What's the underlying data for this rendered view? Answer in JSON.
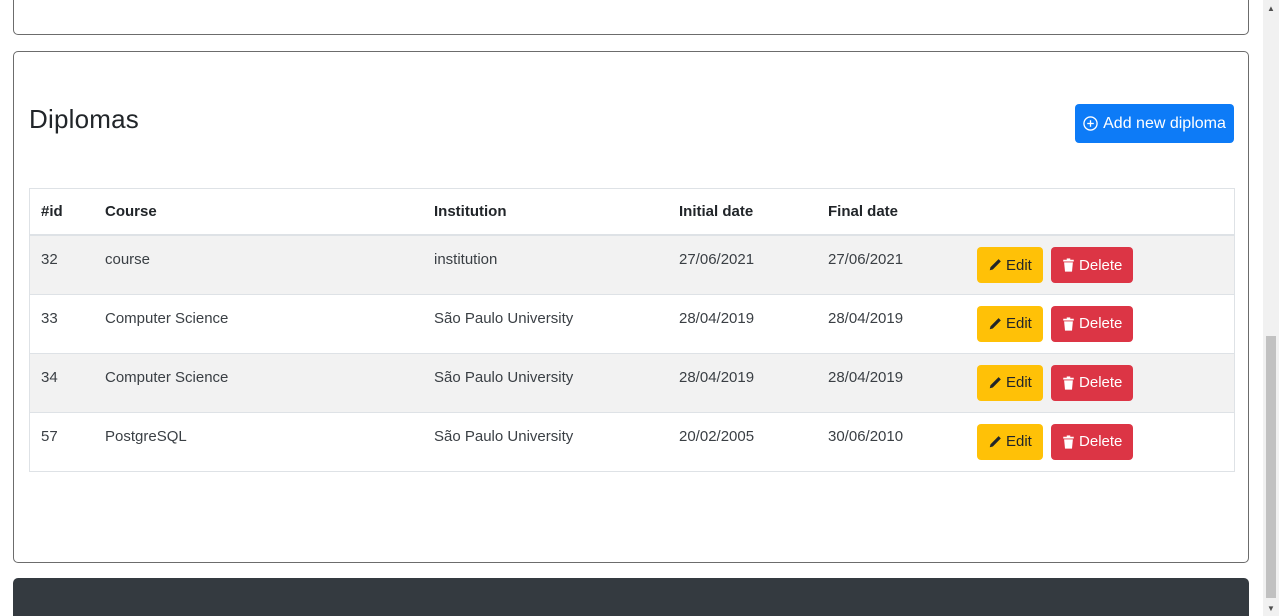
{
  "section": {
    "title": "Diplomas",
    "add_button_label": "Add new diploma"
  },
  "table": {
    "headers": [
      "#id",
      "Course",
      "Institution",
      "Initial date",
      "Final date",
      ""
    ],
    "rows": [
      {
        "id": "32",
        "course": "course",
        "institution": "institution",
        "initial_date": "27/06/2021",
        "final_date": "27/06/2021"
      },
      {
        "id": "33",
        "course": "Computer Science",
        "institution": "São Paulo University",
        "initial_date": "28/04/2019",
        "final_date": "28/04/2019"
      },
      {
        "id": "34",
        "course": "Computer Science",
        "institution": "São Paulo University",
        "initial_date": "28/04/2019",
        "final_date": "28/04/2019"
      },
      {
        "id": "57",
        "course": "PostgreSQL",
        "institution": "São Paulo University",
        "initial_date": "20/02/2005",
        "final_date": "30/06/2010"
      }
    ],
    "edit_label": "Edit",
    "delete_label": "Delete"
  },
  "icons": {
    "add": "plus-circle-icon",
    "edit": "pencil-icon",
    "delete": "trash-icon"
  },
  "colors": {
    "primary": "#0d7bf7",
    "warning": "#ffc107",
    "danger": "#dc3545",
    "footer": "#343a40"
  }
}
